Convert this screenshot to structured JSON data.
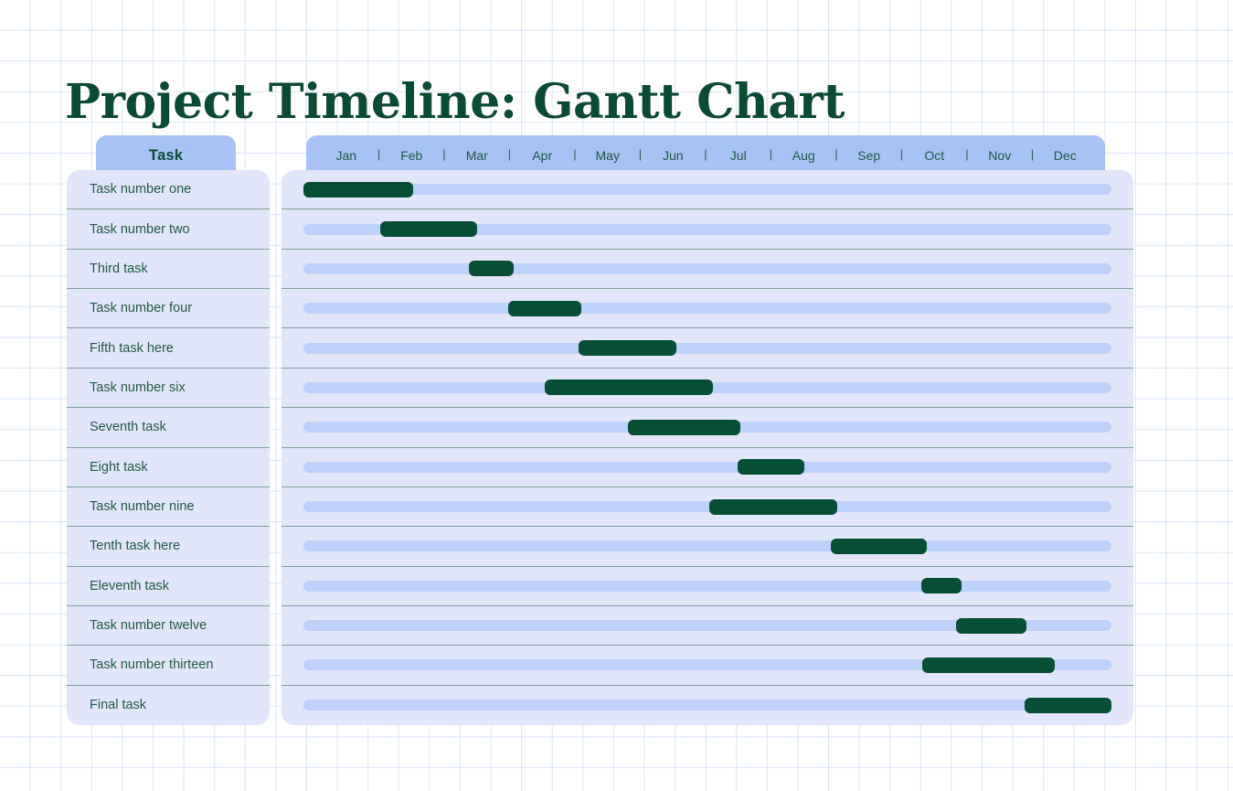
{
  "page": {
    "title": "Project Timeline: Gantt Chart",
    "background": "#ffffff",
    "grid_color": "#d8e6f8"
  },
  "colors": {
    "title_green": "#0b4a33",
    "header_tab_blue": "#a9c2f5",
    "panel_lavender": "#e2e6fa",
    "track_blue": "#bdd1fb",
    "progress_green": "#064e35",
    "divider": "#7e9f96",
    "task_text": "#1f5a44"
  },
  "task_column": {
    "header_label": "Task"
  },
  "timeline": {
    "separator": "|",
    "months": [
      "Jan",
      "Feb",
      "Mar",
      "Apr",
      "May",
      "Jun",
      "Jul",
      "Aug",
      "Sep",
      "Oct",
      "Nov",
      "Dec"
    ]
  },
  "chart_data": {
    "type": "bar",
    "title": "Project Timeline: Gantt Chart",
    "xlabel": "",
    "ylabel": "Task",
    "orientation": "horizontal",
    "grid": false,
    "legend": null,
    "x_axis": {
      "categories": [
        "Jan",
        "Feb",
        "Mar",
        "Apr",
        "May",
        "Jun",
        "Jul",
        "Aug",
        "Sep",
        "Oct",
        "Nov",
        "Dec"
      ],
      "range_months": [
        1,
        12
      ]
    },
    "categories": [
      "Task number one",
      "Task number two",
      "Third task",
      "Task number four",
      "Fifth task here",
      "Task number six",
      "Seventh task",
      "Eight task",
      "Task number nine",
      "Tenth task here",
      "Eleventh task",
      "Task number twelve",
      "Task number thirteen",
      "Final task"
    ],
    "bars": [
      {
        "task": "Task number one",
        "start_pct": 0.0,
        "end_pct": 13.6,
        "start_month": "Jan",
        "end_month": "Feb"
      },
      {
        "task": "Task number two",
        "start_pct": 9.5,
        "end_pct": 21.5,
        "start_month": "Feb",
        "end_month": "Mar"
      },
      {
        "task": "Third task",
        "start_pct": 20.5,
        "end_pct": 26.0,
        "start_month": "Mar",
        "end_month": "Apr"
      },
      {
        "task": "Task number four",
        "start_pct": 25.3,
        "end_pct": 34.4,
        "start_month": "Apr",
        "end_month": "May"
      },
      {
        "task": "Fifth task here",
        "start_pct": 34.1,
        "end_pct": 46.1,
        "start_month": "May",
        "end_month": "Jun"
      },
      {
        "task": "Task number six",
        "start_pct": 29.9,
        "end_pct": 50.7,
        "start_month": "Apr",
        "end_month": "Jul"
      },
      {
        "task": "Seventh task",
        "start_pct": 40.2,
        "end_pct": 54.1,
        "start_month": "Jun",
        "end_month": "Jul"
      },
      {
        "task": "Eight task",
        "start_pct": 53.7,
        "end_pct": 62.0,
        "start_month": "Jul",
        "end_month": "Aug"
      },
      {
        "task": "Task number nine",
        "start_pct": 50.2,
        "end_pct": 66.1,
        "start_month": "Jul",
        "end_month": "Sep"
      },
      {
        "task": "Tenth task here",
        "start_pct": 65.3,
        "end_pct": 77.2,
        "start_month": "Sep",
        "end_month": "Oct"
      },
      {
        "task": "Eleventh task",
        "start_pct": 76.5,
        "end_pct": 81.5,
        "start_month": "Oct",
        "end_month": "Oct"
      },
      {
        "task": "Task number twelve",
        "start_pct": 80.8,
        "end_pct": 89.5,
        "start_month": "Oct",
        "end_month": "Nov"
      },
      {
        "task": "Task number thirteen",
        "start_pct": 76.6,
        "end_pct": 93.0,
        "start_month": "Oct",
        "end_month": "Dec"
      },
      {
        "task": "Final task",
        "start_pct": 89.3,
        "end_pct": 100.0,
        "start_month": "Nov",
        "end_month": "Dec"
      }
    ]
  }
}
